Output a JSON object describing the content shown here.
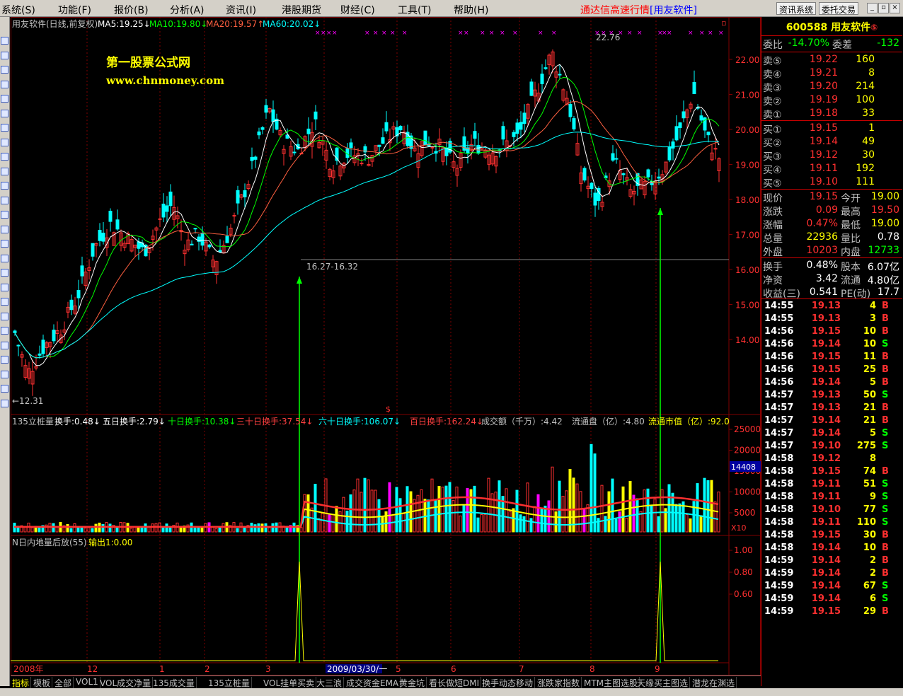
{
  "menu": [
    "系统(S)",
    "功能(F)",
    "报价(B)",
    "分析(A)",
    "资讯(I)",
    "港股期货",
    "财经(C)",
    "工具(T)",
    "帮助(H)"
  ],
  "promo": {
    "text": "通达信高速行情",
    "link": "[用友软件]"
  },
  "sys_buttons": [
    "资讯系统",
    "委托交易"
  ],
  "window_controls": [
    "minimize-icon",
    "restore-icon",
    "close-icon"
  ],
  "main": {
    "title": "用友软件(日线,前复权)",
    "ma": [
      {
        "label": "MA5:19.25",
        "arrow": "↓",
        "color": "#ffffff"
      },
      {
        "label": "MA10:19.80",
        "arrow": "↓",
        "color": "#00ff00"
      },
      {
        "label": "MA20:19.57",
        "arrow": "↑",
        "color": "#ff6040"
      },
      {
        "label": "MA60:20.02",
        "arrow": "↓",
        "color": "#00ffff"
      }
    ],
    "watermark": [
      "第一股票公式网",
      "www.chnmoney.com"
    ],
    "price_axis": [
      "22.00",
      "21.00",
      "20.00",
      "19.00",
      "18.00",
      "17.00",
      "16.00",
      "15.00",
      "14.00"
    ],
    "high_label": "22.76",
    "low_label": "←12.31",
    "range_label": "16.27-16.32"
  },
  "vol": {
    "title": "135立桩量",
    "items": [
      {
        "label": "换手:0.48",
        "color": "#ffffff"
      },
      {
        "label": "五日换手:2.79",
        "color": "#ffffff"
      },
      {
        "label": "十日换手:10.38",
        "color": "#00ff00"
      },
      {
        "label": "三十日换手:37.54",
        "color": "#ff4040"
      },
      {
        "label": "六十日换手:106.07",
        "color": "#00ffff"
      },
      {
        "label": "百日换手:162.24",
        "color": "#ff4040"
      },
      {
        "label": "成交额（千万）:4.42",
        "color": "#c0c0c0"
      },
      {
        "label": "流通盘（亿）:4.80",
        "color": "#c0c0c0"
      },
      {
        "label": "流通市值（亿）:92.0",
        "color": "#ffff00"
      }
    ],
    "axis": [
      "25000",
      "20000",
      "15000",
      "10000",
      "5000"
    ],
    "current": "14408",
    "multiplier": "X10"
  },
  "ind": {
    "title": "N日内地量后放(55)",
    "output": "输出1:0.00",
    "axis": [
      "1.00",
      "0.80",
      "0.60"
    ]
  },
  "date_axis": [
    "2008年",
    "12",
    "1",
    "2",
    "3",
    "2009/03/30/一",
    "5",
    "6",
    "7",
    "8",
    "9"
  ],
  "tabs": [
    "指标",
    "模板",
    "全部",
    "VOL1",
    "VOL成交净量",
    "135成交量",
    "135立桩量",
    "VOL挂单买卖",
    "大三浪",
    "成交资金EMA",
    "黄金坑",
    "看长做短DMI",
    "换手动态移动",
    "涨跌家指数",
    "MTM主图选股",
    "天缘买主图选",
    "潜龙在渊选"
  ],
  "stock": {
    "code": "600588",
    "name": "用友软件",
    "badge": "⑤"
  },
  "weibi": {
    "label1": "委比",
    "val1": "-14.70%",
    "label2": "委差",
    "val2": "-132"
  },
  "sells": [
    {
      "label": "卖⑤",
      "price": "19.22",
      "vol": "160"
    },
    {
      "label": "卖④",
      "price": "19.21",
      "vol": "8"
    },
    {
      "label": "卖③",
      "price": "19.20",
      "vol": "214"
    },
    {
      "label": "卖②",
      "price": "19.19",
      "vol": "100"
    },
    {
      "label": "卖①",
      "price": "19.18",
      "vol": "33"
    }
  ],
  "buys": [
    {
      "label": "买①",
      "price": "19.15",
      "vol": "1"
    },
    {
      "label": "买②",
      "price": "19.14",
      "vol": "49"
    },
    {
      "label": "买③",
      "price": "19.12",
      "vol": "30"
    },
    {
      "label": "买④",
      "price": "19.11",
      "vol": "192"
    },
    {
      "label": "买⑤",
      "price": "19.10",
      "vol": "111"
    }
  ],
  "quote": [
    {
      "l1": "现价",
      "v1": "19.15",
      "c1": "#ff3030",
      "l2": "今开",
      "v2": "19.00",
      "c2": "#ffff00"
    },
    {
      "l1": "涨跌",
      "v1": "0.09",
      "c1": "#ff3030",
      "l2": "最高",
      "v2": "19.50",
      "c2": "#ff3030"
    },
    {
      "l1": "涨幅",
      "v1": "0.47%",
      "c1": "#ff3030",
      "l2": "最低",
      "v2": "19.00",
      "c2": "#ffff00"
    },
    {
      "l1": "总量",
      "v1": "22936",
      "c1": "#ffff00",
      "l2": "量比",
      "v2": "0.78",
      "c2": "#ffffff"
    },
    {
      "l1": "外盘",
      "v1": "10203",
      "c1": "#ff3030",
      "l2": "内盘",
      "v2": "12733",
      "c2": "#00ff00"
    }
  ],
  "fin": [
    {
      "l1": "换手",
      "v1": "0.48%",
      "l2": "股本",
      "v2": "6.07亿"
    },
    {
      "l1": "净资",
      "v1": "3.42",
      "l2": "流通",
      "v2": "4.80亿"
    },
    {
      "l1": "收益(三)",
      "v1": "0.541",
      "l2": "PE(动)",
      "v2": "17.7"
    }
  ],
  "ticks": [
    {
      "t": "14:55",
      "p": "19.13",
      "v": "4",
      "s": "B"
    },
    {
      "t": "14:55",
      "p": "19.13",
      "v": "3",
      "s": "B"
    },
    {
      "t": "14:56",
      "p": "19.15",
      "v": "10",
      "s": "B"
    },
    {
      "t": "14:56",
      "p": "19.14",
      "v": "10",
      "s": "S"
    },
    {
      "t": "14:56",
      "p": "19.15",
      "v": "11",
      "s": "B"
    },
    {
      "t": "14:56",
      "p": "19.15",
      "v": "25",
      "s": "B"
    },
    {
      "t": "14:56",
      "p": "19.14",
      "v": "5",
      "s": "B"
    },
    {
      "t": "14:57",
      "p": "19.13",
      "v": "50",
      "s": "S"
    },
    {
      "t": "14:57",
      "p": "19.13",
      "v": "21",
      "s": "B"
    },
    {
      "t": "14:57",
      "p": "19.14",
      "v": "21",
      "s": "B"
    },
    {
      "t": "14:57",
      "p": "19.14",
      "v": "5",
      "s": "S"
    },
    {
      "t": "14:57",
      "p": "19.10",
      "v": "275",
      "s": "S"
    },
    {
      "t": "14:58",
      "p": "19.12",
      "v": "8",
      "s": ""
    },
    {
      "t": "14:58",
      "p": "19.15",
      "v": "74",
      "s": "B"
    },
    {
      "t": "14:58",
      "p": "19.11",
      "v": "51",
      "s": "S"
    },
    {
      "t": "14:58",
      "p": "19.11",
      "v": "9",
      "s": "S"
    },
    {
      "t": "14:58",
      "p": "19.10",
      "v": "77",
      "s": "S"
    },
    {
      "t": "14:58",
      "p": "19.11",
      "v": "110",
      "s": "S"
    },
    {
      "t": "14:58",
      "p": "19.15",
      "v": "30",
      "s": "B"
    },
    {
      "t": "14:58",
      "p": "19.14",
      "v": "10",
      "s": "B"
    },
    {
      "t": "14:59",
      "p": "19.14",
      "v": "2",
      "s": "B"
    },
    {
      "t": "14:59",
      "p": "19.14",
      "v": "2",
      "s": "B"
    },
    {
      "t": "14:59",
      "p": "19.14",
      "v": "67",
      "s": "S"
    },
    {
      "t": "14:59",
      "p": "19.14",
      "v": "6",
      "s": "S"
    },
    {
      "t": "14:59",
      "p": "19.15",
      "v": "29",
      "s": "B"
    }
  ],
  "colors": {
    "up": "#ff3030",
    "down": "#00ffff",
    "grid": "#800000",
    "arrow": "#00ff00",
    "bg": "#000000"
  }
}
